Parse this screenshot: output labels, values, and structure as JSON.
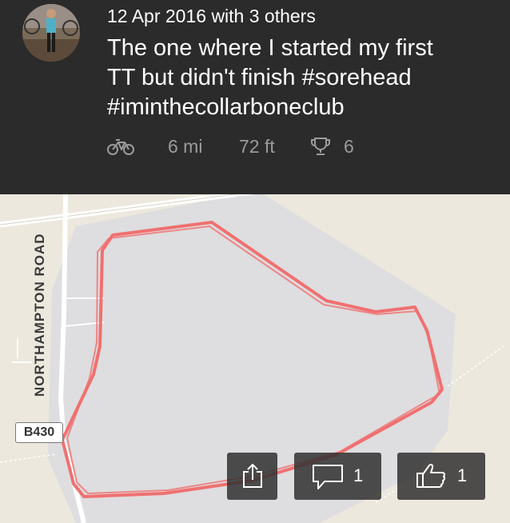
{
  "activity": {
    "date_line": "12 Apr 2016 with 3 others",
    "title_lines": [
      "The one where I started my first",
      "TT but didn't finish #sorehead",
      "#iminthecollarboneclub"
    ],
    "distance": "6 mi",
    "elevation": "72 ft",
    "achievements": "6",
    "sport_icon": "bike-icon",
    "achievement_icon": "trophy-icon"
  },
  "map": {
    "road_name": "NORTHAMPTON ROAD",
    "road_shield": "B430",
    "route_color": "#f07070",
    "background_color": "#ece8dd",
    "area_color": "#dedddf"
  },
  "actions": {
    "share_icon": "share-icon",
    "comment_icon": "comment-icon",
    "comment_count": "1",
    "kudos_icon": "thumbs-up-icon",
    "kudos_count": "1"
  }
}
